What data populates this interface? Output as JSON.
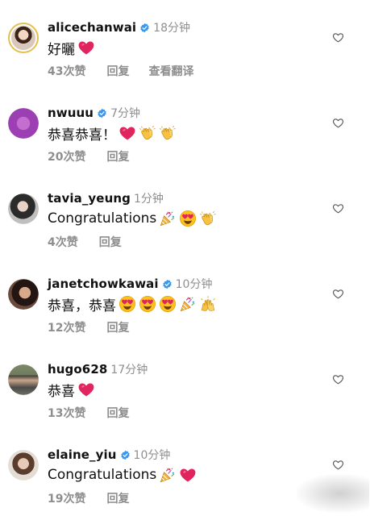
{
  "comments": [
    {
      "username": "alicechanwai",
      "verified": true,
      "time": "18分钟",
      "text": "好曬",
      "emojis": [
        "red-heart"
      ],
      "likes": "43次赞",
      "reply": "回复",
      "translate": "查看翻译"
    },
    {
      "username": "nwuuu",
      "verified": true,
      "time": "7分钟",
      "text": "恭喜恭喜！",
      "emojis": [
        "red-heart",
        "clapping-hands",
        "clapping-hands"
      ],
      "likes": "20次赞",
      "reply": "回复"
    },
    {
      "username": "tavia_yeung",
      "verified": false,
      "time": "1分钟",
      "text": "Congratulations",
      "emojis": [
        "party-popper",
        "heart-eyes-face",
        "clapping-hands"
      ],
      "likes": "4次赞",
      "reply": "回复"
    },
    {
      "username": "janetchowkawai",
      "verified": true,
      "time": "10分钟",
      "text": "恭喜，恭喜",
      "emojis": [
        "heart-eyes-face",
        "heart-eyes-face",
        "heart-eyes-face",
        "party-popper",
        "raising-hands"
      ],
      "likes": "12次赞",
      "reply": "回复"
    },
    {
      "username": "hugo628",
      "verified": false,
      "time": "17分钟",
      "text": "恭喜",
      "emojis": [
        "red-heart"
      ],
      "likes": "13次赞",
      "reply": "回复"
    },
    {
      "username": "elaine_yiu",
      "verified": true,
      "time": "10分钟",
      "text": "Congratulations",
      "emojis": [
        "party-popper",
        "red-heart"
      ],
      "likes": "19次赞",
      "reply": "回复"
    }
  ],
  "colors": {
    "verified_blue": "#3897f0",
    "meta_gray": "#8e8e8e",
    "heart_red": "#e0245e"
  },
  "icons": {
    "like_button": "heart-outline-icon",
    "verified": "verified-badge-icon"
  }
}
